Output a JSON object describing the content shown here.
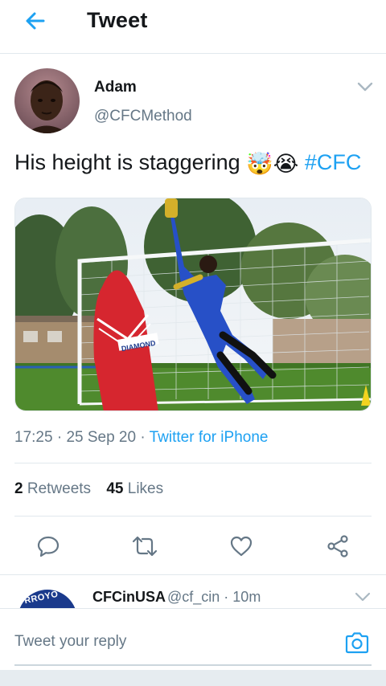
{
  "header": {
    "title": "Tweet",
    "back_icon": "arrow-left-icon"
  },
  "tweet": {
    "author_name": "Adam",
    "author_handle": "@CFCMethod",
    "text": "His height is staggering",
    "emojis": [
      "🤯",
      "😭"
    ],
    "hashtag": "#CFC",
    "time": "17:25",
    "date": "25 Sep 20",
    "source": "Twitter for iPhone",
    "retweets_count": "2",
    "retweets_label": "Retweets",
    "likes_count": "45",
    "likes_label": "Likes",
    "media_sign_text": "DIAMOND"
  },
  "actions": [
    {
      "name": "reply",
      "icon": "reply-bubble-icon"
    },
    {
      "name": "retweet",
      "icon": "retweet-icon"
    },
    {
      "name": "like",
      "icon": "heart-icon"
    },
    {
      "name": "share",
      "icon": "share-icon"
    }
  ],
  "reply_preview": {
    "name": "CFCinUSA",
    "handle": "@cf_cin",
    "time": "10m",
    "avatar_text": "RROYO"
  },
  "compose": {
    "placeholder": "Tweet your reply",
    "camera_icon": "camera-icon"
  },
  "colors": {
    "accent": "#1da1f2",
    "muted": "#657786",
    "border": "#e1e8ed",
    "text": "#14171a"
  }
}
